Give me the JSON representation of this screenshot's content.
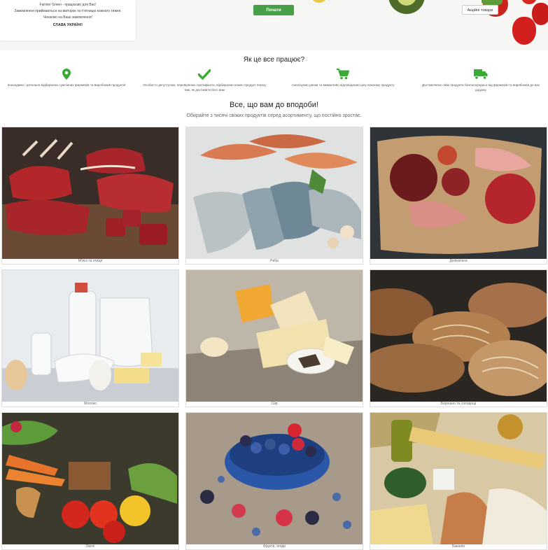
{
  "hero": {
    "lines": [
      "Farmer Green - працюємо для Вас!",
      "Замовлення приймаються на вівторок та п'ятницю кожного тижня.",
      "Чекаємо на Ваші замовлення!",
      "СЛАВА УКРАЇНІ!"
    ],
    "start_button": "Почати купувати",
    "promo_button": "Акційні товари"
  },
  "how": {
    "title": "Як це все працює?",
    "steps": [
      {
        "icon": "map-pin-icon",
        "text": "Знаходимо і ретельно відбираємо сумлінних фермерів та виробників продуктів"
      },
      {
        "icon": "checkmark-icon",
        "text": "Особисто дегустуємо, перевіряємо сертифікати, відбираємо кожен продукт перед тим, як доставити його вам"
      },
      {
        "icon": "shopping-cart-icon",
        "text": "Аналізуємо ринки та виважливо відповідаємо ціну кожному продукту"
      },
      {
        "icon": "truck-icon",
        "text": "Доставляємо свіжі продукти безпосередньо від фермерів та виробників до вас додому"
      }
    ]
  },
  "catalog": {
    "title": "Все, що вам до вподоби!",
    "subtitle": "Обирайте з тисячі свіжих продуктів серед асортименту, що постійно зростає.",
    "categories": [
      {
        "label": "М'ясо та птиця",
        "image": "meat"
      },
      {
        "label": "Риба",
        "image": "fish"
      },
      {
        "label": "Делікатеси",
        "image": "deli"
      },
      {
        "label": "Молоко",
        "image": "milk"
      },
      {
        "label": "Сир",
        "image": "cheese"
      },
      {
        "label": "Борошно та солодощі",
        "image": "bread"
      },
      {
        "label": "Овочі",
        "image": "vegetables"
      },
      {
        "label": "Фрукти, ягоди",
        "image": "berries"
      },
      {
        "label": "Бакалія",
        "image": "grocery"
      }
    ]
  },
  "colors": {
    "accent_green": "#47a047",
    "icon_green": "#3aaa35"
  }
}
